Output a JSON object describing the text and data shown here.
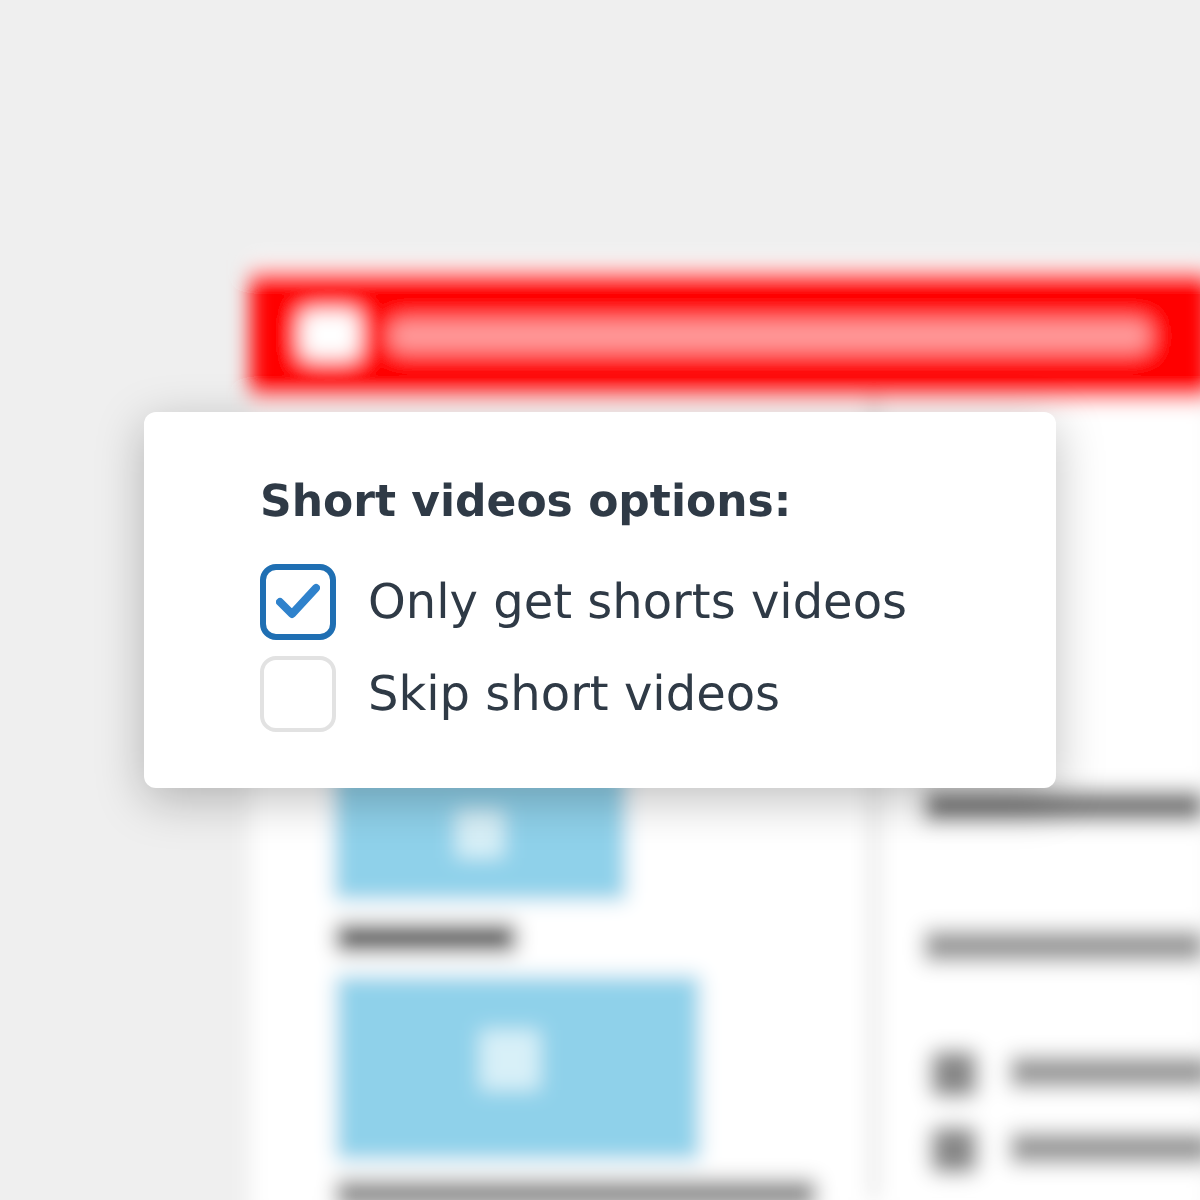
{
  "options_card": {
    "title": "Short videos options:",
    "options": [
      {
        "label": "Only get shorts videos",
        "checked": true
      },
      {
        "label": "Skip short videos",
        "checked": false
      }
    ]
  }
}
